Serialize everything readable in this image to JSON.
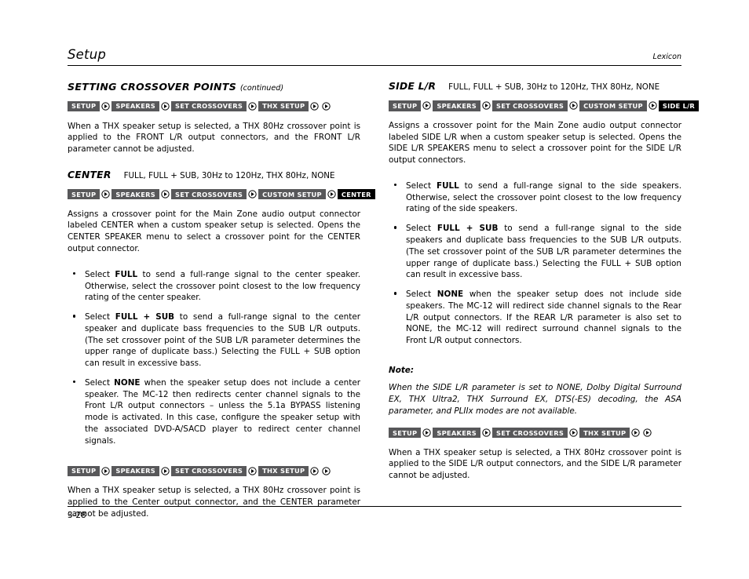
{
  "header": {
    "title": "Setup",
    "brand": "Lexicon"
  },
  "footer": {
    "page_number": "3-28"
  },
  "icons": {
    "separator": "circle-right-arrow-icon"
  },
  "left_column": {
    "section_title": "SETTING CROSSOVER POINTS",
    "section_title_continued": "(continued)",
    "crumbs_thx_1": [
      {
        "label": "SETUP",
        "active": false
      },
      {
        "label": "SPEAKERS",
        "active": false
      },
      {
        "label": "SET CROSSOVERS",
        "active": false
      },
      {
        "label": "THX SETUP",
        "active": false
      }
    ],
    "crumbs_thx_1_trailing_arrows": 2,
    "intro_paragraph": "When a THX speaker setup is selected, a THX 80Hz crossover point is applied to the FRONT L/R output connectors, and the FRONT L/R parameter cannot be adjusted.",
    "param_name": "CENTER",
    "param_values": "FULL, FULL + SUB, 30Hz to 120Hz, THX 80Hz, NONE",
    "crumbs_center": [
      {
        "label": "SETUP",
        "active": false
      },
      {
        "label": "SPEAKERS",
        "active": false
      },
      {
        "label": "SET CROSSOVERS",
        "active": false
      },
      {
        "label": "CUSTOM SETUP",
        "active": false
      },
      {
        "label": "CENTER",
        "active": true
      }
    ],
    "description": "Assigns a crossover point for the Main Zone audio output connector labeled CENTER when a custom speaker setup is selected. Opens the CENTER SPEAKER menu to select a crossover point for the CENTER output connector.",
    "bullets": [
      {
        "pre": "Select ",
        "bold": "FULL",
        "post": " to send a full-range signal to the center speaker. Otherwise, select the crossover point closest to the low frequency rating of the center speaker."
      },
      {
        "pre": "Select ",
        "bold": "FULL + SUB",
        "post": " to send a full-range signal to the center speaker and duplicate bass frequencies to the SUB L/R outputs. (The set crossover point of the SUB L/R parameter determines the upper range of duplicate bass.) Selecting the FULL + SUB option can result in excessive bass."
      },
      {
        "pre": "Select ",
        "bold": "NONE",
        "post": " when the speaker setup does not include a center speaker. The MC-12 then redirects center channel signals to the Front L/R output connectors – unless the 5.1a BYPASS listening mode is activated. In this case, configure the speaker setup with the associated DVD-A/SACD player to redirect center channel signals."
      }
    ],
    "crumbs_thx_2": [
      {
        "label": "SETUP",
        "active": false
      },
      {
        "label": "SPEAKERS",
        "active": false
      },
      {
        "label": "SET CROSSOVERS",
        "active": false
      },
      {
        "label": "THX SETUP",
        "active": false
      }
    ],
    "crumbs_thx_2_trailing_arrows": 2,
    "closing_paragraph": "When a THX speaker setup is selected, a THX 80Hz crossover point is applied to the Center output connector, and the CENTER parameter cannot be adjusted."
  },
  "right_column": {
    "param_name": "SIDE L/R",
    "param_values": "FULL, FULL + SUB, 30Hz to 120Hz, THX 80Hz, NONE",
    "crumbs_side": [
      {
        "label": "SETUP",
        "active": false
      },
      {
        "label": "SPEAKERS",
        "active": false
      },
      {
        "label": "SET CROSSOVERS",
        "active": false
      },
      {
        "label": "CUSTOM SETUP",
        "active": false
      },
      {
        "label": "SIDE L/R",
        "active": true
      }
    ],
    "description": "Assigns a crossover point for the Main Zone audio output connector labeled SIDE L/R when a custom speaker setup is selected. Opens the SIDE L/R SPEAKERS menu to select a crossover point for the SIDE L/R output connectors.",
    "bullets": [
      {
        "pre": "Select ",
        "bold": "FULL",
        "post": " to send a full-range signal to the side speakers. Otherwise, select the crossover point closest to the low frequency rating of the side speakers."
      },
      {
        "pre": "Select ",
        "bold": "FULL + SUB",
        "post": " to send a full-range signal to the side speakers and duplicate bass frequencies to the SUB L/R outputs. (The set crossover point of the SUB L/R parameter determines the upper range of duplicate bass.) Selecting the FULL + SUB option can result in excessive bass."
      },
      {
        "pre": "Select ",
        "bold": "NONE",
        "post": " when the speaker setup does not include side speakers. The MC-12 will redirect side channel signals to the Rear L/R output connectors. If the REAR L/R parameter is also set to NONE, the MC-12 will redirect surround channel signals to the Front L/R output connectors."
      }
    ],
    "note_label": "Note:",
    "note_body": "When the SIDE L/R parameter is set to NONE, Dolby Digital Surround EX, THX Ultra2, THX Surround EX, DTS(-ES) decoding, the ASA parameter, and PLIIx modes are not available.",
    "crumbs_thx": [
      {
        "label": "SETUP",
        "active": false
      },
      {
        "label": "SPEAKERS",
        "active": false
      },
      {
        "label": "SET CROSSOVERS",
        "active": false
      },
      {
        "label": "THX SETUP",
        "active": false
      }
    ],
    "crumbs_thx_trailing_arrows": 2,
    "closing_paragraph": "When a THX speaker setup is selected, a THX 80Hz crossover point is applied to the SIDE L/R output connectors, and the SIDE L/R parameter cannot be adjusted."
  }
}
